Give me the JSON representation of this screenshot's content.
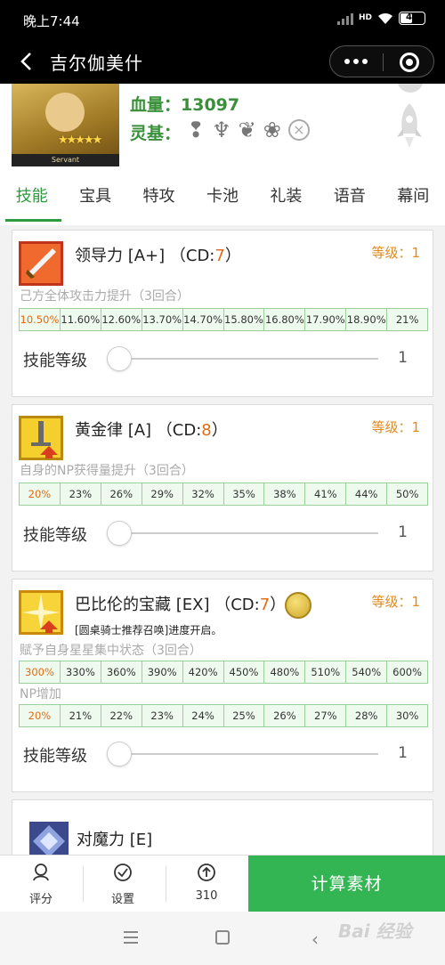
{
  "status_bar": {
    "time": "晚上7:44",
    "network": "HD",
    "battery": "44"
  },
  "nav": {
    "title": "吉尔伽美什"
  },
  "hero": {
    "hp_label": "血量：13097",
    "spirit_label": "灵基：",
    "stars": "★★★★★",
    "plate": "Servant"
  },
  "tabs": [
    "技能",
    "宝具",
    "特攻",
    "卡池",
    "礼装",
    "语音",
    "幕间"
  ],
  "skills": [
    {
      "name": "领导力 [A+] （CD:",
      "cd": "7",
      "cd_close": "）",
      "level": "等级：1",
      "effects": [
        {
          "desc": "己方全体攻击力提升（3回合）",
          "values": [
            "10.50%",
            "11.60%",
            "12.60%",
            "13.70%",
            "14.70%",
            "15.80%",
            "16.80%",
            "17.90%",
            "18.90%",
            "21%"
          ]
        }
      ],
      "slider_label": "技能等级",
      "slider_value": "1"
    },
    {
      "name": "黄金律 [A] （CD:",
      "cd": "8",
      "cd_close": "）",
      "level": "等级：1",
      "effects": [
        {
          "desc": "自身的NP获得量提升（3回合）",
          "values": [
            "20%",
            "23%",
            "26%",
            "29%",
            "32%",
            "35%",
            "38%",
            "41%",
            "44%",
            "50%"
          ]
        }
      ],
      "slider_label": "技能等级",
      "slider_value": "1"
    },
    {
      "name": "巴比伦的宝藏 [EX] （CD:",
      "cd": "7",
      "cd_close": "）",
      "level": "等级：1",
      "note": "[圆桌骑士推荐召唤]进度开启。",
      "effects": [
        {
          "desc": "赋予自身星星集中状态（3回合）",
          "values": [
            "300%",
            "330%",
            "360%",
            "390%",
            "420%",
            "450%",
            "480%",
            "510%",
            "540%",
            "600%"
          ]
        },
        {
          "desc": "NP增加",
          "values": [
            "20%",
            "21%",
            "22%",
            "23%",
            "24%",
            "25%",
            "26%",
            "27%",
            "28%",
            "30%"
          ]
        }
      ],
      "slider_label": "技能等级",
      "slider_value": "1"
    }
  ],
  "passive": {
    "name": "对魔力 [E]"
  },
  "bottom_bar": {
    "rate_label": "评分",
    "settings_label": "设置",
    "count_label": "310",
    "calc_button": "计算素材"
  },
  "watermark": "Bai 经验",
  "colors": {
    "accent": "#2c9a3d",
    "cd": "#e36b14",
    "level": "#e08a1f",
    "button": "#33b553"
  }
}
